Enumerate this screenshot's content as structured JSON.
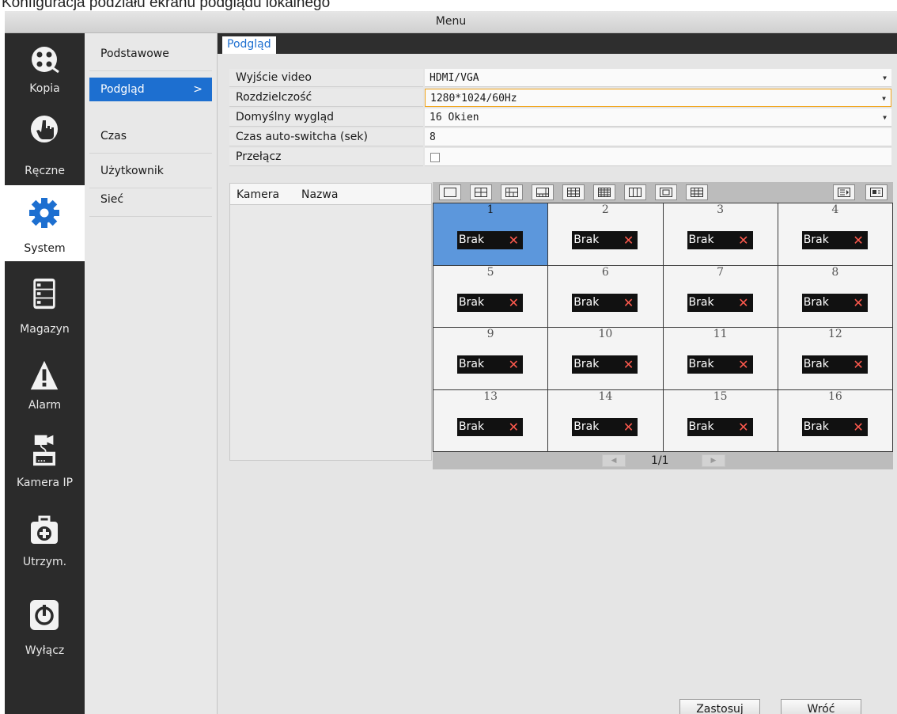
{
  "caption": "Konfiguracja podziału ekranu podglądu lokalnego",
  "window": {
    "title": "Menu"
  },
  "rail": {
    "items": [
      {
        "label": "Kopia",
        "icon": "film-reel-icon"
      },
      {
        "label": "Ręczne",
        "icon": "hand-pointer-icon"
      },
      {
        "label": "System",
        "icon": "gear-icon",
        "active": true
      },
      {
        "label": "Magazyn",
        "icon": "storage-drives-icon"
      },
      {
        "label": "Alarm",
        "icon": "warning-icon"
      },
      {
        "label": "Kamera IP",
        "icon": "ip-camera-icon"
      },
      {
        "label": "Utrzym.",
        "icon": "maintenance-kit-icon"
      },
      {
        "label": "Wyłącz",
        "icon": "power-icon"
      }
    ]
  },
  "submenu": {
    "items": [
      {
        "label": "Podstawowe"
      },
      {
        "label": "Podgląd",
        "active": true,
        "chevron": ">"
      },
      {
        "label": "Czas"
      },
      {
        "label": "Użytkownik"
      },
      {
        "label": "Sieć"
      }
    ]
  },
  "tab": {
    "label": "Podgląd"
  },
  "settings": {
    "video_output": {
      "label": "Wyjście video",
      "value": "HDMI/VGA"
    },
    "resolution": {
      "label": "Rozdzielczość",
      "value": "1280*1024/60Hz"
    },
    "default_layout": {
      "label": "Domyślny wygląd",
      "value": "16 Okien"
    },
    "auto_switch": {
      "label": "Czas auto-switcha (sek)",
      "value": "8"
    },
    "switch": {
      "label": "Przełącz",
      "checked": false
    }
  },
  "camera_list": {
    "col_camera": "Kamera",
    "col_name": "Nazwa"
  },
  "grid": {
    "cells": [
      {
        "num": "1",
        "tag": "Brak",
        "selected": true
      },
      {
        "num": "2",
        "tag": "Brak"
      },
      {
        "num": "3",
        "tag": "Brak"
      },
      {
        "num": "4",
        "tag": "Brak"
      },
      {
        "num": "5",
        "tag": "Brak"
      },
      {
        "num": "6",
        "tag": "Brak"
      },
      {
        "num": "7",
        "tag": "Brak"
      },
      {
        "num": "8",
        "tag": "Brak"
      },
      {
        "num": "9",
        "tag": "Brak"
      },
      {
        "num": "10",
        "tag": "Brak"
      },
      {
        "num": "11",
        "tag": "Brak"
      },
      {
        "num": "12",
        "tag": "Brak"
      },
      {
        "num": "13",
        "tag": "Brak"
      },
      {
        "num": "14",
        "tag": "Brak"
      },
      {
        "num": "15",
        "tag": "Brak"
      },
      {
        "num": "16",
        "tag": "Brak"
      }
    ],
    "page": "1/1"
  },
  "buttons": {
    "apply": "Zastosuj",
    "back": "Wróć"
  },
  "colors": {
    "accent": "#1d6fd0",
    "selected_cell": "#5c97dc",
    "focus_border": "#f2a51c",
    "remove_x": "#ff5a4e"
  }
}
